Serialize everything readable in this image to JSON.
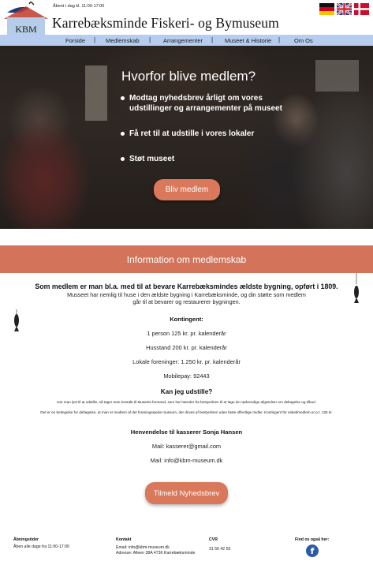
{
  "header": {
    "hours": "Åbent i dag kl. 11:00-17:00",
    "title": "Karrebæksminde Fiskeri- og Bymuseum",
    "logo_text": "KBM",
    "flags": [
      "german-flag-icon",
      "uk-flag-icon",
      "danish-flag-icon"
    ]
  },
  "nav": {
    "items": [
      {
        "label": "Forside"
      },
      {
        "label": "Medlemskab"
      },
      {
        "label": "Arrangementer"
      },
      {
        "label": "Museet & Historie"
      },
      {
        "label": "Om Os"
      }
    ],
    "separator": "|"
  },
  "hero": {
    "title": "Hvorfor blive medlem?",
    "bullets": [
      "Modtag nyhedsbrev årligt om vores udstillinger og arrangementer på museet",
      "Få ret til at udstille i vores lokaler",
      "Støt museet"
    ],
    "button": "Bliv medlem"
  },
  "info": {
    "banner": "Information om medlemskab",
    "lead": "Som medlem er man bl.a. med til at bevare Karrebæksmindes ældste bygning, opført i 1809.",
    "para1": "Musseet har nemlig til huse i den ældste bygning i Karrebæksminde, og din støtte som medlem",
    "para2": "går til at bevarer og restaurerer bygningen.",
    "kontingent_heading": "Kontingent:",
    "kontingent_items": [
      "1 person 125 kr. pr. kalenderår",
      "Husstand 200 kr. pr. kalenderår",
      "Lokale foreninger: 1.250 kr. pr. kalenderår",
      "Mobilepay: 92443"
    ],
    "exhibit_heading": "Kan jeg udstille?",
    "exhibit_text1": "Har man lyst til at udstille, så tager man kontakt til Museets formand, som har hænder fra bestyrelsen til at tage de nødvendige afgørelser om deltagelse og tilbud.",
    "exhibit_text2": "Det er en betingelse for deltagelse, at man er medlem af det foreningsejede museum, der drives af bestyrelsen uden faste offentlige midler. Kontingent for enkeltmedlem er p.t. 125 kr.",
    "contact_heading": "Henvendelse til kasserer Sonja Hansen",
    "contact_mail1": "Mail: kasserer@gmail.com",
    "contact_mail2": "Mail: info@kbm-museum.dk",
    "newsletter_button": "Tilmeld Nyhedsbrev"
  },
  "footer": {
    "hours_heading": "Åbningstider",
    "hours_text": "Åben alle dage fra 11:00-17:00",
    "contact_heading": "Kontakt",
    "contact_email": "Email: info@kbm-museum.dk",
    "contact_address": "Adresse: Alleen 38A 4736 Karrebæksminde",
    "cvr_heading": "CVR",
    "cvr_number": "31 56 42 55",
    "social_heading": "Find os også her:",
    "social_icon": "facebook-icon"
  },
  "colors": {
    "nav_bg": "#b6cdef",
    "accent": "#d2735a",
    "button": "#d9785a"
  }
}
